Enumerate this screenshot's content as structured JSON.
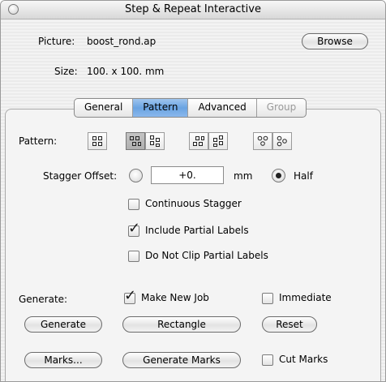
{
  "window": {
    "title": "Step & Repeat Interactive"
  },
  "picture": {
    "label": "Picture:",
    "value": "boost_rond.ap",
    "browse_label": "Browse"
  },
  "size": {
    "label": "Size:",
    "value": "100. x 100. mm"
  },
  "tabs": [
    {
      "label": "General",
      "state": "normal"
    },
    {
      "label": "Pattern",
      "state": "active"
    },
    {
      "label": "Advanced",
      "state": "normal"
    },
    {
      "label": "Group",
      "state": "disabled"
    }
  ],
  "pattern": {
    "label": "Pattern:",
    "buttons": [
      {
        "icon": "pattern-grid-icon",
        "selected": false
      },
      {
        "icon": "pattern-stagger-h-icon",
        "selected": true
      },
      {
        "icon": "pattern-stagger-v-icon",
        "selected": false
      },
      {
        "icon": "pattern-stagger-h-alt-icon",
        "selected": false
      },
      {
        "icon": "pattern-stagger-v-alt-icon",
        "selected": false
      },
      {
        "icon": "pattern-round-stagger-icon",
        "selected": false
      },
      {
        "icon": "pattern-round-stagger-alt-icon",
        "selected": false
      }
    ]
  },
  "stagger": {
    "label": "Stagger Offset:",
    "value": "+0.",
    "unit": "mm",
    "half_label": "Half",
    "half_selected": true,
    "offset_selected": false
  },
  "options": {
    "continuous_stagger": {
      "label": "Continuous Stagger",
      "checked": false
    },
    "include_partial": {
      "label": "Include Partial Labels",
      "checked": true
    },
    "do_not_clip": {
      "label": "Do Not Clip Partial Labels",
      "checked": false
    }
  },
  "generate": {
    "label": "Generate:",
    "make_new_job": {
      "label": "Make New Job",
      "checked": true
    },
    "immediate": {
      "label": "Immediate",
      "checked": false
    },
    "generate_button": "Generate",
    "rectangle_button": "Rectangle",
    "reset_button": "Reset",
    "marks_button": "Marks...",
    "generate_marks_button": "Generate Marks",
    "cut_marks": {
      "label": "Cut Marks",
      "checked": false
    }
  },
  "check_glyph": "✓",
  "colors": {
    "tab_active": "#8ab8ec",
    "selected_button": "#b8b8b8"
  }
}
